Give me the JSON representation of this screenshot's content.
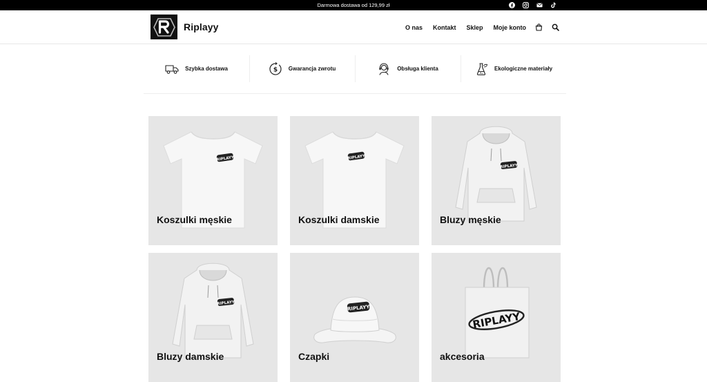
{
  "topbar": {
    "promo": "Darmowa dostawa od 129,99 zł",
    "social": [
      "facebook-icon",
      "instagram-icon",
      "mail-icon",
      "tiktok-icon"
    ]
  },
  "header": {
    "brand": "Riplayy",
    "nav": [
      "O nas",
      "Kontakt",
      "Sklep",
      "Moje konto"
    ]
  },
  "features": [
    {
      "icon": "truck-icon",
      "label": "Szybka dostawa"
    },
    {
      "icon": "refund-icon",
      "label": "Gwarancja zwrotu"
    },
    {
      "icon": "support-icon",
      "label": "Obsługa klienta"
    },
    {
      "icon": "eco-icon",
      "label": "Ekologiczne materiały"
    }
  ],
  "categories": [
    {
      "label": "Koszulki męskie",
      "art": "tshirt"
    },
    {
      "label": "Koszulki damskie",
      "art": "tshirt"
    },
    {
      "label": "Bluzy męskie",
      "art": "hoodie"
    },
    {
      "label": "Bluzy damskie",
      "art": "hoodie"
    },
    {
      "label": "Czapki",
      "art": "hat"
    },
    {
      "label": "akcesoria",
      "art": "bag"
    }
  ],
  "colors": {
    "topbar": "#000000",
    "card_bg": "#e6e6e6",
    "text": "#111111"
  }
}
